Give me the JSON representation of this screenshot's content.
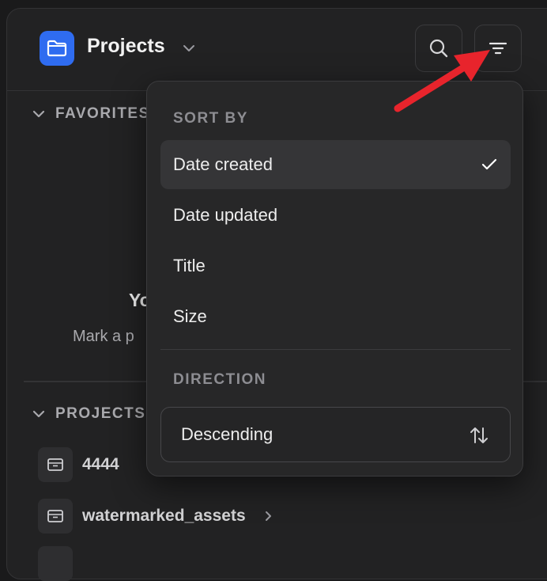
{
  "header": {
    "title": "Projects",
    "app_icon": "folder-icon",
    "accent": "#2f6cf0"
  },
  "favorites": {
    "label": "FAVORITES",
    "empty_title": "Yo",
    "empty_subtitle": "Mark a p"
  },
  "projects": {
    "label": "PROJECTS",
    "items": [
      {
        "name": "4444"
      },
      {
        "name": "watermarked_assets"
      },
      {
        "name": ""
      }
    ]
  },
  "sort_menu": {
    "sort_by_label": "SORT BY",
    "options": [
      {
        "label": "Date created",
        "selected": true
      },
      {
        "label": "Date updated",
        "selected": false
      },
      {
        "label": "Title",
        "selected": false
      },
      {
        "label": "Size",
        "selected": false
      }
    ],
    "direction_label": "DIRECTION",
    "direction_value": "Descending"
  },
  "annotation": {
    "color": "#e8242c"
  }
}
